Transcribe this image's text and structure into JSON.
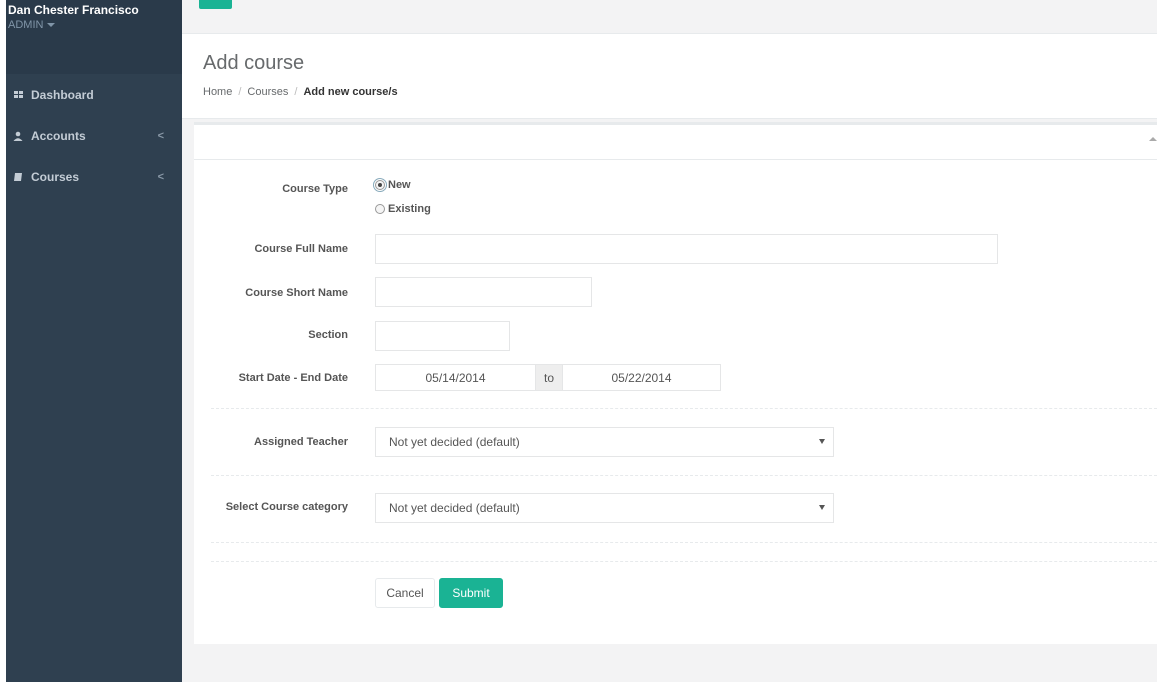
{
  "sidebar": {
    "user_name": "Dan Chester Francisco",
    "user_role": "ADMIN",
    "items": [
      {
        "label": "Dashboard",
        "icon": "th-large-icon"
      },
      {
        "label": "Accounts",
        "icon": "user-icon",
        "chevron": "<"
      },
      {
        "label": "Courses",
        "icon": "book-icon",
        "chevron": "<"
      }
    ]
  },
  "page": {
    "title": "Add course",
    "breadcrumb": [
      "Home",
      "Courses",
      "Add new course/s"
    ],
    "breadcrumb_sep": "/"
  },
  "form": {
    "course_type_label": "Course Type",
    "course_type_options": [
      {
        "label": "New",
        "checked": true
      },
      {
        "label": "Existing",
        "checked": false
      }
    ],
    "full_name_label": "Course Full Name",
    "full_name_value": "",
    "short_name_label": "Course Short Name",
    "short_name_value": "",
    "section_label": "Section",
    "section_value": "",
    "date_label": "Start Date - End Date",
    "start_date": "05/14/2014",
    "date_separator": "to",
    "end_date": "05/22/2014",
    "teacher_label": "Assigned Teacher",
    "teacher_value": "Not yet decided (default)",
    "category_label": "Select Course category",
    "category_value": "Not yet decided (default)",
    "cancel_label": "Cancel",
    "submit_label": "Submit"
  },
  "colors": {
    "sidebar_bg": "#2f4050",
    "accent": "#1ab394",
    "content_bg": "#f3f3f4"
  }
}
